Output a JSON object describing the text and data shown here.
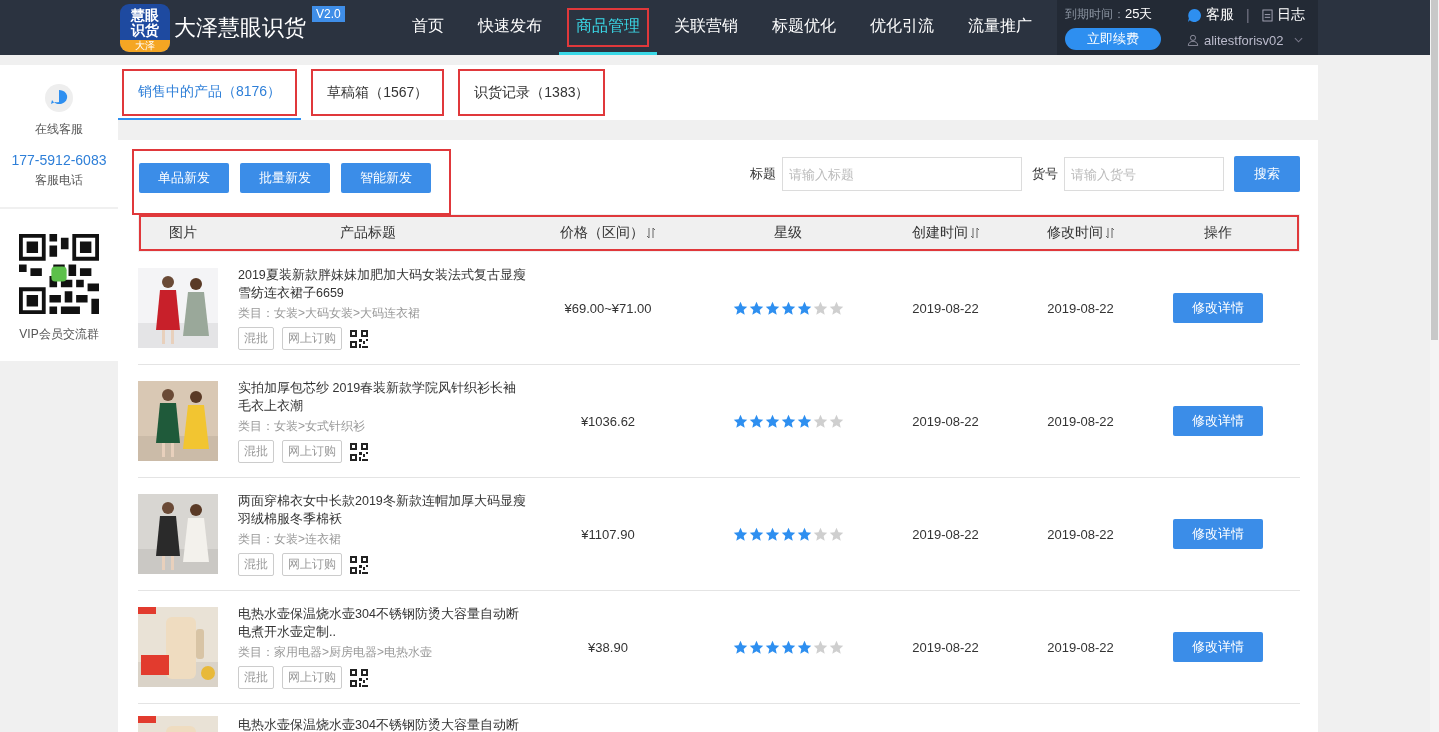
{
  "header": {
    "logo_text": "慧眼识货",
    "logo_badge": "大泽",
    "brand": "大泽慧眼识货",
    "version": "V2.0",
    "nav": [
      {
        "label": "首页",
        "selected": false,
        "highlighted": false
      },
      {
        "label": "快速发布",
        "selected": false,
        "highlighted": false
      },
      {
        "label": "商品管理",
        "selected": true,
        "highlighted": true
      },
      {
        "label": "关联营销",
        "selected": false,
        "highlighted": false
      },
      {
        "label": "标题优化",
        "selected": false,
        "highlighted": false
      },
      {
        "label": "优化引流",
        "selected": false,
        "highlighted": false
      },
      {
        "label": "流量推广",
        "selected": false,
        "highlighted": false
      }
    ],
    "expiry_label": "到期时间：",
    "expiry_value": "25天",
    "renew_button": "立即续费",
    "service": "客服",
    "separator": "|",
    "log": "日志",
    "user": "alitestforisv02"
  },
  "sidebar": {
    "service_label": "在线客服",
    "phone": "177-5912-6083",
    "phone_label": "客服电话",
    "qr_label": "VIP会员交流群"
  },
  "tabs": [
    {
      "label": "销售中的产品（8176）",
      "selected": true,
      "highlighted": true
    },
    {
      "label": "草稿箱（1567）",
      "selected": false,
      "highlighted": true
    },
    {
      "label": "识货记录（1383）",
      "selected": false,
      "highlighted": true
    }
  ],
  "toolbar": {
    "highlighted": true,
    "buttons": [
      "单品新发",
      "批量新发",
      "智能新发"
    ],
    "fields": [
      {
        "label": "标题",
        "placeholder": "请输入标题"
      },
      {
        "label": "货号",
        "placeholder": "请输入货号"
      }
    ],
    "search_button": "搜索"
  },
  "table": {
    "highlighted": true,
    "columns": [
      {
        "label": "图片",
        "sortable": false
      },
      {
        "label": "产品标题",
        "sortable": false
      },
      {
        "label": "价格（区间）",
        "sortable": true
      },
      {
        "label": "星级",
        "sortable": false
      },
      {
        "label": "创建时间",
        "sortable": true
      },
      {
        "label": "修改时间",
        "sortable": true
      },
      {
        "label": "操作",
        "sortable": false
      }
    ],
    "rows": [
      {
        "title_lines": [
          "2019夏装新款胖妹妹加肥加大码女装法式复古显瘦",
          "雪纺连衣裙子6659"
        ],
        "category": "类目：女装>大码女装>大码连衣裙",
        "tags": [
          "混批",
          "网上订购"
        ],
        "price": "¥69.00~¥71.00",
        "stars": 5,
        "created": "2019-08-22",
        "modified": "2019-08-22",
        "action": "修改详情"
      },
      {
        "title_lines": [
          "实拍加厚包芯纱 2019春装新款学院风针织衫长袖",
          "毛衣上衣潮"
        ],
        "category": "类目：女装>女式针织衫",
        "tags": [
          "混批",
          "网上订购"
        ],
        "price": "¥1036.62",
        "stars": 5,
        "created": "2019-08-22",
        "modified": "2019-08-22",
        "action": "修改详情"
      },
      {
        "title_lines": [
          "两面穿棉衣女中长款2019冬新款连帽加厚大码显瘦",
          "羽绒棉服冬季棉袄"
        ],
        "category": "类目：女装>连衣裙",
        "tags": [
          "混批",
          "网上订购"
        ],
        "price": "¥1107.90",
        "stars": 5,
        "created": "2019-08-22",
        "modified": "2019-08-22",
        "action": "修改详情"
      },
      {
        "title_lines": [
          "电热水壶保温烧水壶304不锈钢防烫大容量自动断",
          "电煮开水壶定制.."
        ],
        "category": "类目：家用电器>厨房电器>电热水壶",
        "tags": [
          "混批",
          "网上订购"
        ],
        "price": "¥38.90",
        "stars": 5,
        "created": "2019-08-22",
        "modified": "2019-08-22",
        "action": "修改详情"
      },
      {
        "title_lines": [
          "电热水壶保温烧水壶304不锈钢防烫大容量自动断"
        ]
      }
    ]
  }
}
